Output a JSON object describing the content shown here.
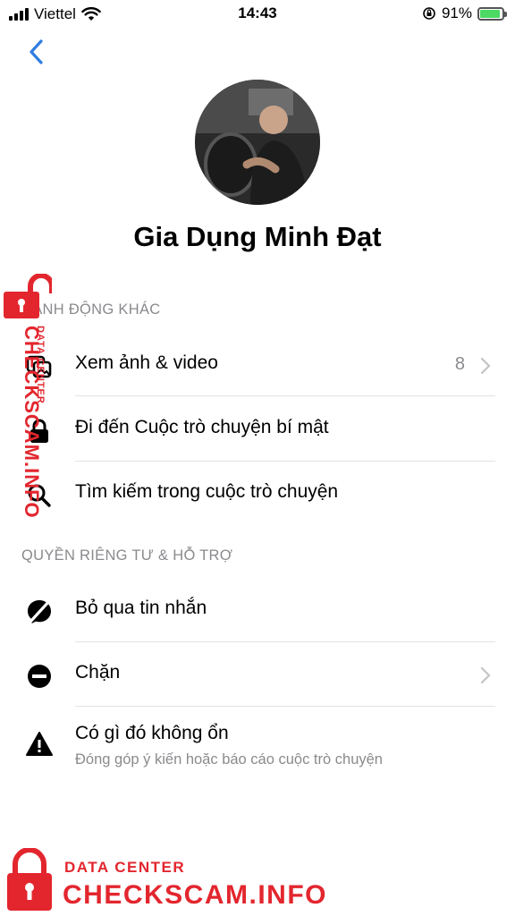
{
  "status_bar": {
    "carrier": "Viettel",
    "time": "14:43",
    "battery_percent": "91%",
    "battery_level": 0.91,
    "icons": [
      "signal-icon",
      "wifi-icon",
      "orientation-lock-icon",
      "battery-charging-icon"
    ]
  },
  "nav": {
    "back_icon": "chevron-left-icon",
    "accent": "#2f7de1"
  },
  "profile": {
    "name": "Gia Dụng Minh Đạt"
  },
  "sections": {
    "more_actions": {
      "header": "HÀNH ĐỘNG KHÁC",
      "items": [
        {
          "label": "Xem ảnh & video",
          "count": "8",
          "icon": "photos-icon"
        },
        {
          "label": "Đi đến Cuộc trò chuyện bí mật",
          "icon": "lock-icon"
        },
        {
          "label": "Tìm kiếm trong cuộc trò chuyện",
          "icon": "search-icon"
        }
      ]
    },
    "privacy": {
      "header": "QUYỀN RIÊNG TƯ & HỖ TRỢ",
      "items": [
        {
          "label": "Bỏ qua tin nhắn",
          "icon": "ignore-messages-icon"
        },
        {
          "label": "Chặn",
          "icon": "block-icon"
        },
        {
          "label": "Có gì đó không ổn",
          "subtitle": "Đóng góp ý kiến hoặc báo cáo cuộc trò chuyện",
          "icon": "warning-icon"
        }
      ]
    }
  },
  "watermark": {
    "small_text": "DATA CENTER",
    "big_text": "CHECKSCAM.INFO",
    "color": "#e3262e"
  }
}
